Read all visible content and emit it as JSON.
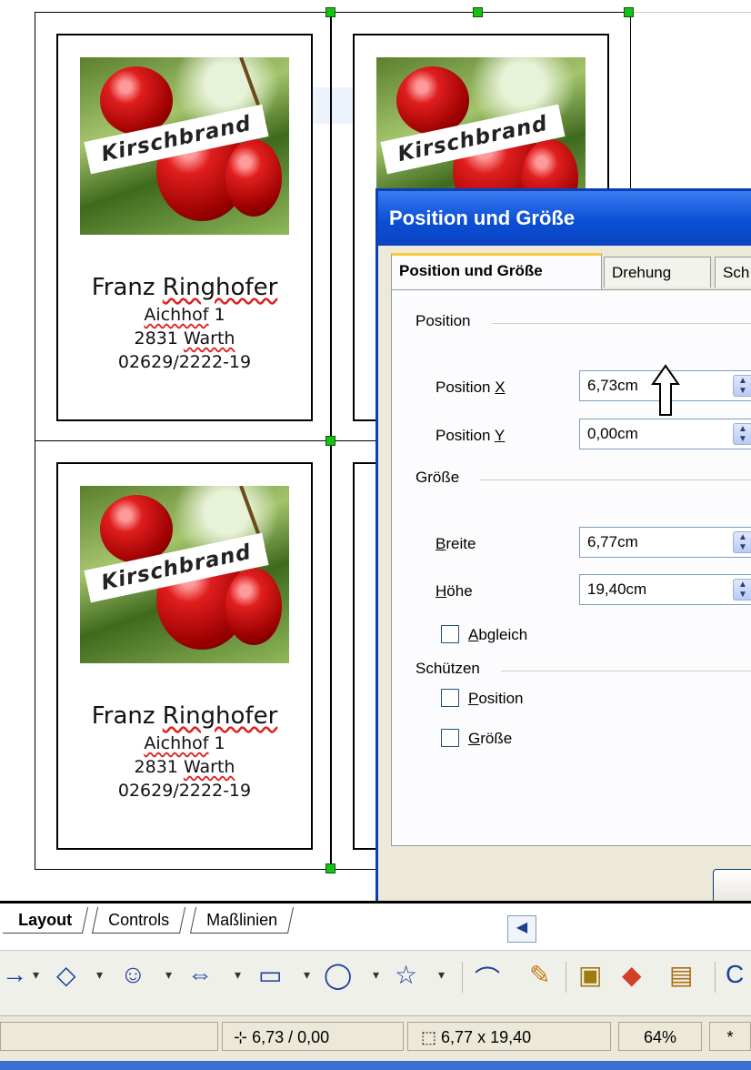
{
  "card": {
    "banner": "Kirschbrand",
    "name_first": "Franz",
    "name_last": "Ringhofer",
    "street_word": "Aichhof",
    "street_num": "1",
    "zip": "2831",
    "city": "Warth",
    "phone": "02629/2222-19"
  },
  "dialog": {
    "title": "Position und Größe",
    "tabs": [
      "Position und Größe",
      "Drehung",
      "Sch"
    ],
    "position_group": "Position",
    "pos_x_label_pre": "Position ",
    "pos_x_label_key": "X",
    "pos_x_value": "6,73cm",
    "pos_y_label_pre": "Position ",
    "pos_y_label_key": "Y",
    "pos_y_value": "0,00cm",
    "size_group": "Größe",
    "width_key": "B",
    "width_rest": "reite",
    "width_value": "6,77cm",
    "height_key": "H",
    "height_rest": "öhe",
    "height_value": "19,40cm",
    "keep_ratio_key": "A",
    "keep_ratio_rest": "bgleich",
    "protect_group": "Schützen",
    "protect_pos_key": "P",
    "protect_pos_rest": "osition",
    "protect_size_key": "G",
    "protect_size_rest": "röße"
  },
  "sheet_tabs": [
    "Layout",
    "Controls",
    "Maßlinien"
  ],
  "status": {
    "position": "6,73 / 0,00",
    "size": "6,77 x 19,40",
    "zoom": "64%",
    "modified": "*"
  }
}
